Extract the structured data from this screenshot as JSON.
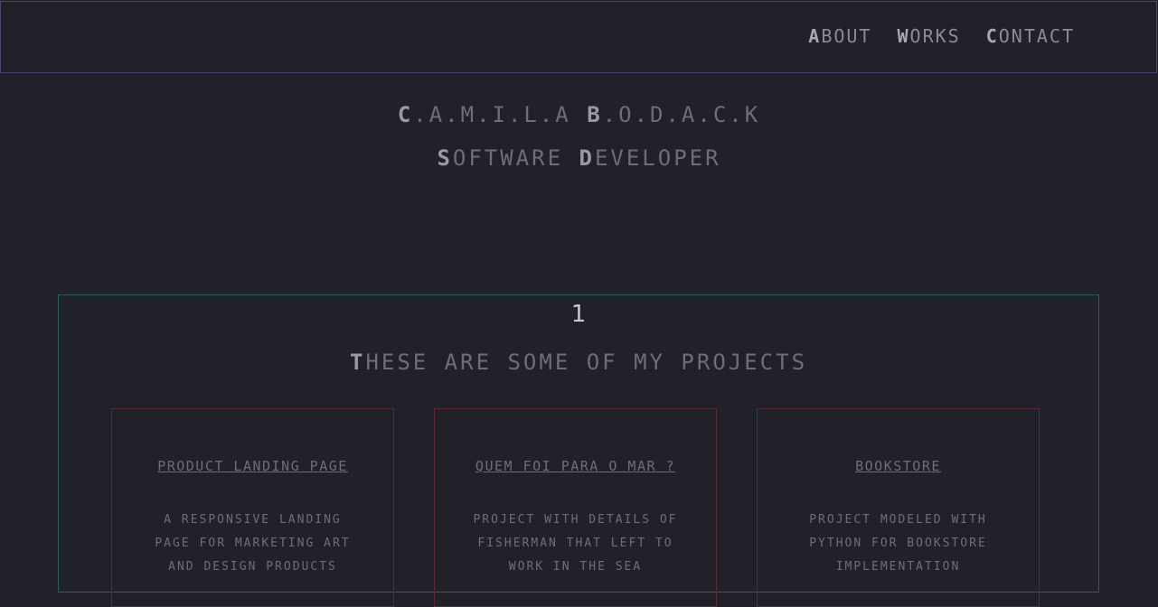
{
  "nav": {
    "links": [
      {
        "first": "A",
        "rest": "BOUT"
      },
      {
        "first": "W",
        "rest": "ORKS"
      },
      {
        "first": "C",
        "rest": "ONTACT"
      }
    ]
  },
  "hero": {
    "name_parts": [
      {
        "first": "C",
        "rest": ".A.M.I.L.A "
      },
      {
        "first": "B",
        "rest": ".O.D.A.C.K"
      }
    ],
    "role_parts": [
      {
        "first": "S",
        "rest": "OFTWARE "
      },
      {
        "first": "D",
        "rest": "EVELOPER"
      }
    ]
  },
  "projects": {
    "number": "1",
    "title_first": "T",
    "title_rest": "HESE ARE SOME OF MY PROJECTS",
    "cards": [
      {
        "title": "PRODUCT LANDING PAGE",
        "description": "A RESPONSIVE LANDING PAGE FOR MARKETING ART AND DESIGN PRODUCTS"
      },
      {
        "title": "QUEM FOI PARA O MAR ?",
        "description": "PROJECT WITH DETAILS OF FISHERMAN THAT LEFT TO WORK IN THE SEA"
      },
      {
        "title": "BOOKSTORE",
        "description": "PROJECT MODELED WITH PYTHON FOR BOOKSTORE IMPLEMENTATION"
      }
    ]
  }
}
